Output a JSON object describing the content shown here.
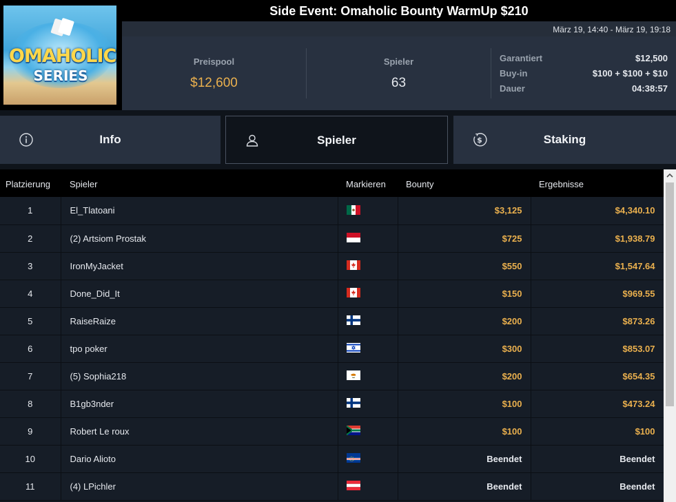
{
  "header": {
    "title": "Side Event: Omaholic Bounty WarmUp $210",
    "dates": "März 19, 14:40 - März 19, 19:18",
    "logo_line1": "OMAHOLIC",
    "logo_line2": "SERIES"
  },
  "stats": {
    "prizepool_label": "Preispool",
    "prizepool_value": "$12,600",
    "players_label": "Spieler",
    "players_value": "63"
  },
  "details": [
    {
      "label": "Garantiert",
      "value": "$12,500"
    },
    {
      "label": "Buy-in",
      "value": "$100 + $100 + $10"
    },
    {
      "label": "Dauer",
      "value": "04:38:57"
    }
  ],
  "tabs": [
    {
      "label": "Info",
      "icon": "info-icon"
    },
    {
      "label": "Spieler",
      "icon": "user-icon",
      "active": true
    },
    {
      "label": "Staking",
      "icon": "dollar-coin-icon"
    }
  ],
  "table": {
    "columns": [
      "Platzierung",
      "Spieler",
      "Markieren",
      "Bounty",
      "Ergebnisse"
    ],
    "rows": [
      {
        "place": "1",
        "player": "El_Tlatoani",
        "flag": "mexico",
        "bounty": "$3,125",
        "result": "$4,340.10"
      },
      {
        "place": "2",
        "player": "(2) Artsiom Prostak",
        "flag": "monaco",
        "bounty": "$725",
        "result": "$1,938.79"
      },
      {
        "place": "3",
        "player": "IronMyJacket",
        "flag": "canada",
        "bounty": "$550",
        "result": "$1,547.64"
      },
      {
        "place": "4",
        "player": "Done_Did_It",
        "flag": "canada",
        "bounty": "$150",
        "result": "$969.55"
      },
      {
        "place": "5",
        "player": "RaiseRaize",
        "flag": "finland",
        "bounty": "$200",
        "result": "$873.26"
      },
      {
        "place": "6",
        "player": "tpo poker",
        "flag": "israel",
        "bounty": "$300",
        "result": "$853.07"
      },
      {
        "place": "7",
        "player": "(5) Sophia218",
        "flag": "cyprus",
        "bounty": "$200",
        "result": "$654.35"
      },
      {
        "place": "8",
        "player": "B1gb3nder",
        "flag": "finland",
        "bounty": "$100",
        "result": "$473.24"
      },
      {
        "place": "9",
        "player": "Robert Le roux",
        "flag": "south-africa",
        "bounty": "$100",
        "result": "$100"
      },
      {
        "place": "10",
        "player": "Dario Alioto",
        "flag": "cape-verde",
        "bounty": "Beendet",
        "result": "Beendet"
      },
      {
        "place": "11",
        "player": "(4) LPichler",
        "flag": "austria",
        "bounty": "Beendet",
        "result": "Beendet"
      }
    ]
  },
  "colors": {
    "accent_gold": "#eab04e",
    "background": "#0f141b",
    "panel": "#283140"
  }
}
